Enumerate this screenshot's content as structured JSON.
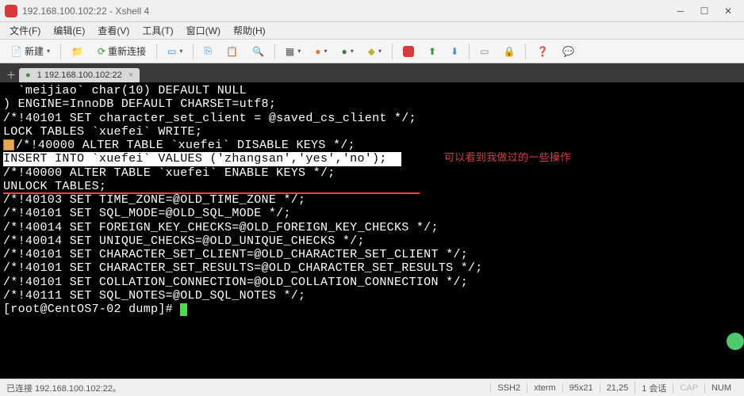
{
  "window": {
    "title": "192.168.100.102:22 - Xshell 4"
  },
  "menu": {
    "file": "文件(F)",
    "edit": "编辑(E)",
    "view": "查看(V)",
    "tools": "工具(T)",
    "window": "窗口(W)",
    "help": "帮助(H)"
  },
  "toolbar": {
    "new": "新建",
    "reconnect": "重新连接"
  },
  "tab": {
    "label": "1 192.168.100.102:22"
  },
  "terminal": {
    "lines": [
      "  `meijiao` char(10) DEFAULT NULL",
      ") ENGINE=InnoDB DEFAULT CHARSET=utf8;",
      "/*!40101 SET character_set_client = @saved_cs_client */;",
      "",
      "",
      "LOCK TABLES `xuefei` WRITE;",
      "/*!40000 ALTER TABLE `xuefei` DISABLE KEYS */;",
      "INSERT INTO `xuefei` VALUES ('zhangsan','yes','no');  ",
      "/*!40000 ALTER TABLE `xuefei` ENABLE KEYS */;",
      "UNLOCK TABLES;",
      "/*!40103 SET TIME_ZONE=@OLD_TIME_ZONE */;",
      "",
      "/*!40101 SET SQL_MODE=@OLD_SQL_MODE */;",
      "/*!40014 SET FOREIGN_KEY_CHECKS=@OLD_FOREIGN_KEY_CHECKS */;",
      "/*!40014 SET UNIQUE_CHECKS=@OLD_UNIQUE_CHECKS */;",
      "/*!40101 SET CHARACTER_SET_CLIENT=@OLD_CHARACTER_SET_CLIENT */;",
      "/*!40101 SET CHARACTER_SET_RESULTS=@OLD_CHARACTER_SET_RESULTS */;",
      "/*!40101 SET COLLATION_CONNECTION=@OLD_COLLATION_CONNECTION */;",
      "/*!40111 SET SQL_NOTES=@OLD_SQL_NOTES */;",
      "",
      "[root@CentOS7-02 dump]# "
    ],
    "annotation": "可以看到我做过的一些操作"
  },
  "status": {
    "connected": "已连接 192.168.100.102:22。",
    "ssh": "SSH2",
    "term": "xterm",
    "size": "95x21",
    "pos": "21,25",
    "sessions": "1 会话",
    "cap": "CAP",
    "num": "NUM"
  }
}
